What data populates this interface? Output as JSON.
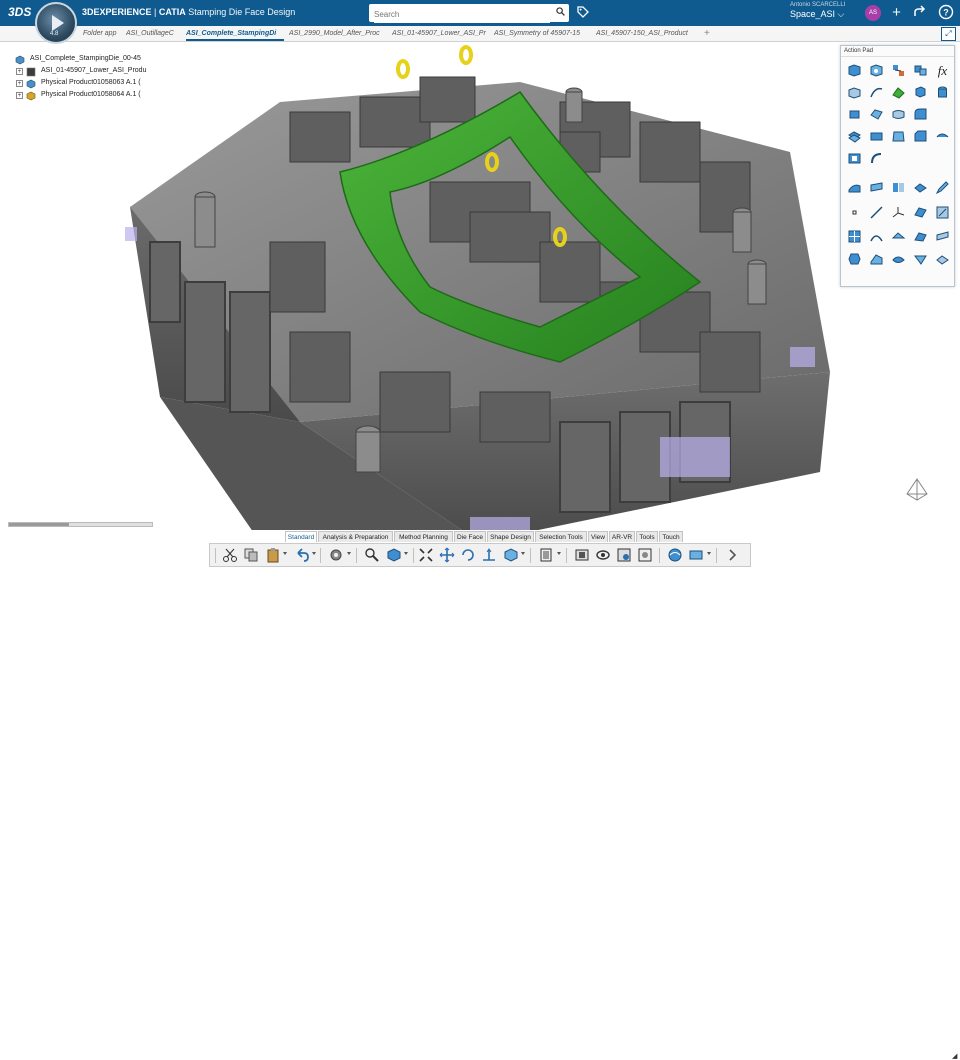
{
  "header": {
    "brand_prefix": "3DEXPERIENCE",
    "brand_app": "CATIA",
    "app_title": "Stamping Die Face Design",
    "search_placeholder": "Search",
    "user_name": "Antonio SCARCELLI",
    "space": "Space_ASI",
    "avatar_initials": "AS",
    "compass_version": "4.8"
  },
  "tabs": [
    {
      "label": "Folder app"
    },
    {
      "label": "ASI_OutillageC"
    },
    {
      "label": "ASI_Complete_StampingDi"
    },
    {
      "label": "ASI_2990_Model_After_Proc"
    },
    {
      "label": "ASI_01-45907_Lower_ASI_Pr"
    },
    {
      "label": "ASI_Symmetry of 45907-15"
    },
    {
      "label": "ASI_45907-150_ASI_Product"
    }
  ],
  "active_tab_index": 2,
  "tree": [
    {
      "label": "ASI_Complete_StampingDie_00-45",
      "expander": "",
      "indent": 0
    },
    {
      "label": "ASI_01-45907_Lower_ASI_Produ",
      "expander": "+",
      "indent": 1
    },
    {
      "label": "Physical Product01058063 A.1 (",
      "expander": "+",
      "indent": 1
    },
    {
      "label": "Physical Product01058064 A.1 (",
      "expander": "+",
      "indent": 1
    }
  ],
  "action_pad": {
    "title": "Action Pad"
  },
  "workbench_tabs": [
    {
      "label": "Standard",
      "active": true
    },
    {
      "label": "Analysis & Preparation",
      "active": false
    },
    {
      "label": "Method Planning",
      "active": false
    },
    {
      "label": "Die Face",
      "active": false
    },
    {
      "label": "Shape Design",
      "active": false
    },
    {
      "label": "Selection Tools",
      "active": false
    },
    {
      "label": "View",
      "active": false
    },
    {
      "label": "AR-VR",
      "active": false
    },
    {
      "label": "Tools",
      "active": false
    },
    {
      "label": "Touch",
      "active": false
    }
  ],
  "colors": {
    "header_bg": "#0f5b8f",
    "accent": "#0f5b8f",
    "part_green": "#3a9a2e",
    "die_gray": "#7c7c7c"
  },
  "icons": {
    "toolbar": [
      "cut-icon",
      "copy-icon",
      "paste-icon",
      "undo-icon",
      "gear-icon",
      "zoom-icon",
      "cube-icon",
      "fit-all-icon",
      "pan-icon",
      "rotate-icon",
      "orient-icon",
      "measure-icon",
      "hide-show-icon",
      "capture-icon",
      "view-icon",
      "render-icon",
      "section-icon",
      "display-icon"
    ]
  }
}
